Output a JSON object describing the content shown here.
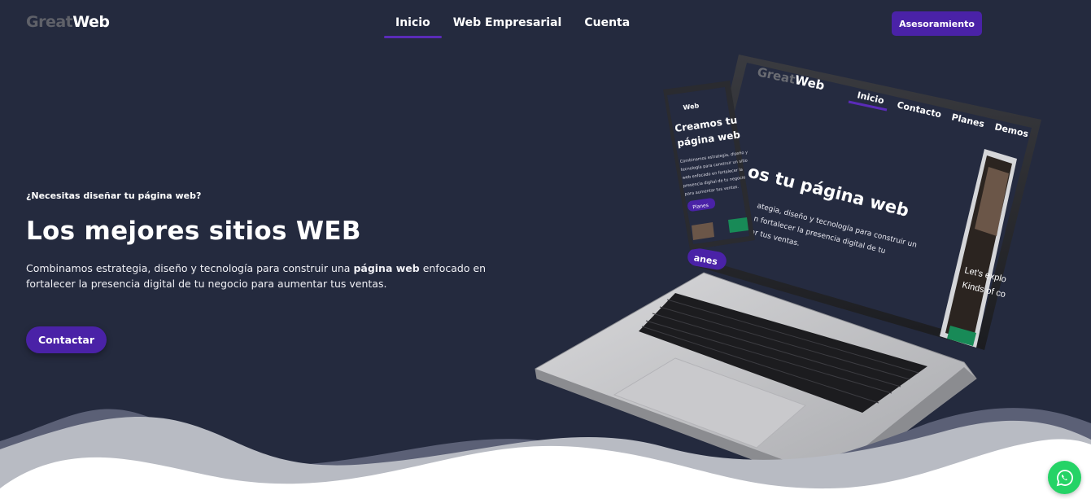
{
  "header": {
    "logo_part1": "Great",
    "logo_part2": "Web",
    "nav": [
      {
        "label": "Inicio",
        "active": true
      },
      {
        "label": "Web Empresarial",
        "active": false
      },
      {
        "label": "Cuenta",
        "active": false
      }
    ],
    "cta_label": "Asesoramiento"
  },
  "hero": {
    "kicker": "¿Necesitas diseñar tu página web?",
    "title": "Los mejores sitios WEB",
    "description_before": "Combinamos estrategia, diseño y tecnología para construir una ",
    "description_bold": "página web",
    "description_after": " enfocado en fortalecer la presencia digital de tu negocio para aumentar tus ventas.",
    "cta_label": "Contactar"
  },
  "mockup": {
    "laptop_logo_part1": "Great",
    "laptop_logo_part2": "Web",
    "laptop_nav": [
      "Inicio",
      "Contacto",
      "Planes",
      "Demos"
    ],
    "laptop_heading": "os tu página web",
    "laptop_text_lines": [
      "ategia, diseño y tecnología para construir un",
      "n fortalecer la presencia digital de tu",
      "ar tus ventas."
    ],
    "laptop_button": "anes",
    "phone_logo": "Web",
    "phone_heading_lines": [
      "Creamos tu",
      "página web"
    ],
    "phone_text_lines": [
      "Combinamos estrategia, diseño y",
      "tecnología para construir un sitio",
      "web enfocado en fortalecer la",
      "presencia digital de tu negocio",
      "para aumentar tus ventas."
    ],
    "phone_button": "Planes",
    "side_phone_lines": [
      "Let's explo",
      "Kinds of co"
    ]
  },
  "colors": {
    "background": "#242a3e",
    "accent": "#4a22a7",
    "whatsapp": "#25d366"
  },
  "icons": {
    "whatsapp": "whatsapp-icon"
  }
}
